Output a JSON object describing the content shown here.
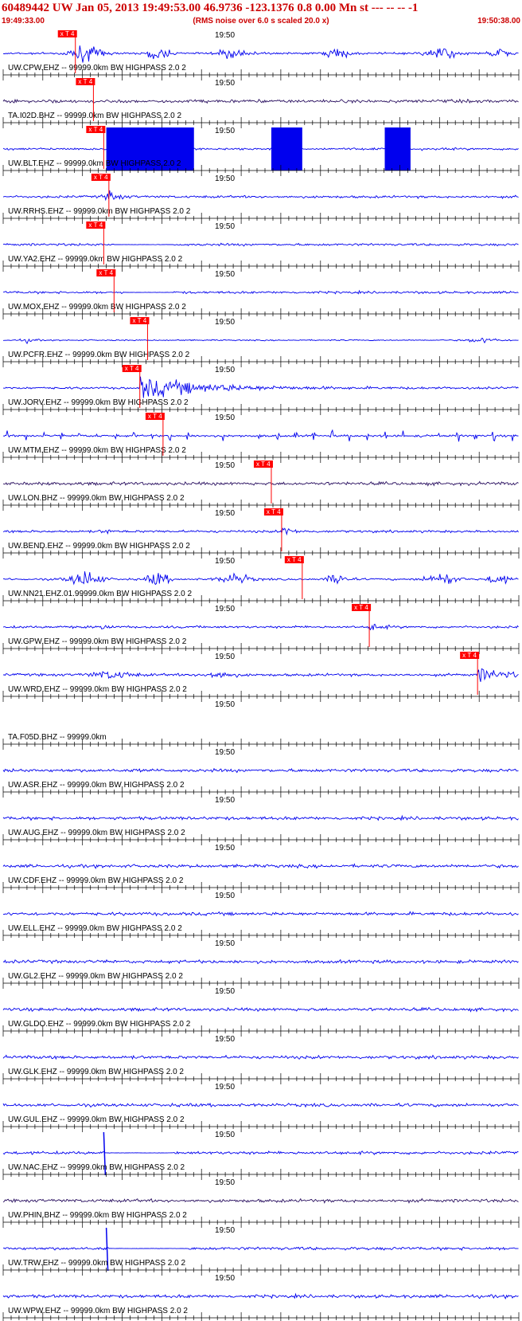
{
  "header": {
    "title": "60489442 UW Jan 05, 2013 19:49:53.00   46.9736 -123.1376  0.8 0.00 Mn st --- -- --  -1",
    "start_time": "19:49:33.00",
    "note": "(RMS noise over 6.0 s scaled 20.0 x)",
    "end_time": "19:50:38.00"
  },
  "time_label": "19:50",
  "pick_label": "x T 4",
  "colors": {
    "trace": "#0000ee",
    "trace_dark": "#2a1060",
    "pick": "#ff0000",
    "axis": "#000000",
    "header": "#cc0000"
  },
  "traces": [
    {
      "label": "UW.CPW.EHZ -- 99999.0km BW  HIGHPASS  2.0  2",
      "color": "trace",
      "pick": 0.14,
      "style": "bursty"
    },
    {
      "label": "TA.I02D.BHZ -- 99999.0km BW  HIGHPASS  2.0  2",
      "color": "trace_dark",
      "pick": 0.175,
      "style": "noise"
    },
    {
      "label": "UW.BLT.EHZ -- 99999.0km BW  HIGHPASS  2.0  2",
      "color": "trace",
      "pick": 0.195,
      "style": "clipped"
    },
    {
      "label": "UW.RRHS.EHZ -- 99999.0km BW  HIGHPASS  2.0  2",
      "color": "trace",
      "pick": 0.205,
      "style": "event"
    },
    {
      "label": "UW.YA2.EHZ -- 99999.0km BW  HIGHPASS  2.0  2",
      "color": "trace",
      "pick": 0.195,
      "style": "dropout"
    },
    {
      "label": "UW.MOX.EHZ -- 99999.0km BW  HIGHPASS  2.0  2",
      "color": "trace",
      "pick": 0.215,
      "style": "dropout"
    },
    {
      "label": "UW.PCFR.EHZ -- 99999.0km BW  HIGHPASS  2.0  2",
      "color": "trace",
      "pick": 0.28,
      "style": "quiet"
    },
    {
      "label": "UW.JORV.EHZ -- 99999.0km BW  HIGHPASS  2.0  2",
      "color": "trace",
      "pick": 0.265,
      "style": "big"
    },
    {
      "label": "UW.MTM.EHZ -- 99999.0km BW  HIGHPASS  2.0  2",
      "color": "trace",
      "pick": 0.31,
      "style": "spiky"
    },
    {
      "label": "UW.LON.BHZ -- 99999.0km BW  HIGHPASS  2.0  2",
      "color": "trace_dark",
      "pick": 0.52,
      "style": "noise"
    },
    {
      "label": "UW.BEND.EHZ -- 99999.0km BW  HIGHPASS  2.0  2",
      "color": "trace",
      "pick": 0.54,
      "style": "event"
    },
    {
      "label": "UW.NN21.EHZ.01.99999.0km BW  HIGHPASS  2.0  2",
      "color": "trace",
      "pick": 0.58,
      "style": "bursty"
    },
    {
      "label": "UW.GPW.EHZ -- 99999.0km BW  HIGHPASS  2.0  2",
      "color": "trace",
      "pick": 0.71,
      "style": "event"
    },
    {
      "label": "UW.WRD.EHZ -- 99999.0km BW  HIGHPASS  2.0  2",
      "color": "trace",
      "pick": 0.92,
      "style": "late"
    },
    {
      "label": "TA.F05D.BHZ -- 99999.0km",
      "color": "trace",
      "pick": null,
      "style": "empty"
    },
    {
      "label": "UW.ASR.EHZ -- 99999.0km BW  HIGHPASS  2.0  2",
      "color": "trace",
      "pick": null,
      "style": "noise"
    },
    {
      "label": "UW.AUG.EHZ -- 99999.0km BW  HIGHPASS  2.0  2",
      "color": "trace",
      "pick": null,
      "style": "noise"
    },
    {
      "label": "UW.CDF.EHZ -- 99999.0km BW  HIGHPASS  2.0  2",
      "color": "trace",
      "pick": null,
      "style": "noise"
    },
    {
      "label": "UW.ELL.EHZ -- 99999.0km BW  HIGHPASS  2.0  2",
      "color": "trace",
      "pick": null,
      "style": "noise"
    },
    {
      "label": "UW.GL2.EHZ -- 99999.0km BW  HIGHPASS  2.0  2",
      "color": "trace",
      "pick": null,
      "style": "noise"
    },
    {
      "label": "UW.GLDO.EHZ -- 99999.0km BW  HIGHPASS  2.0  2",
      "color": "trace",
      "pick": null,
      "style": "noise"
    },
    {
      "label": "UW.GLK.EHZ -- 99999.0km BW  HIGHPASS  2.0  2",
      "color": "trace",
      "pick": null,
      "style": "noise"
    },
    {
      "label": "UW.GUL.EHZ -- 99999.0km BW  HIGHPASS  2.0  2",
      "color": "trace",
      "pick": null,
      "style": "noise"
    },
    {
      "label": "UW.NAC.EHZ -- 99999.0km BW  HIGHPASS  2.0  2",
      "color": "trace",
      "pick": null,
      "style": "nac"
    },
    {
      "label": "UW.PHIN.BHZ -- 99999.0km BW  HIGHPASS  2.0  2",
      "color": "trace_dark",
      "pick": null,
      "style": "noise"
    },
    {
      "label": "UW.TRW.EHZ -- 99999.0km BW  HIGHPASS  2.0  2",
      "color": "trace",
      "pick": null,
      "style": "trw"
    },
    {
      "label": "UW.WPW.EHZ -- 99999.0km BW  HIGHPASS  2.0  2",
      "color": "trace",
      "pick": null,
      "style": "noise"
    }
  ]
}
